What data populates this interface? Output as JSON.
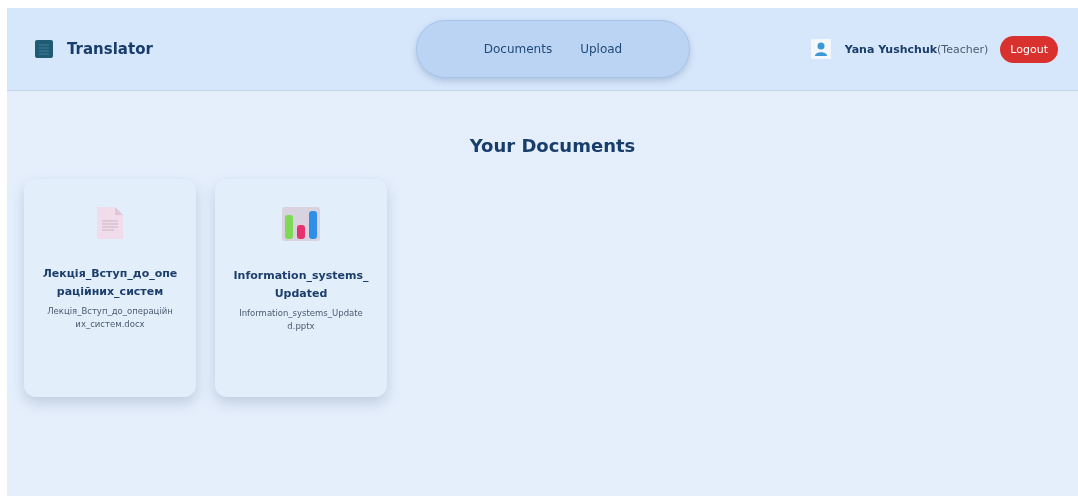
{
  "header": {
    "brand": "Translator",
    "nav": [
      {
        "label": "Documents",
        "selected": false
      },
      {
        "label": "Upload",
        "selected": false
      }
    ],
    "user": {
      "name": "Yana Yushchuk",
      "role": "(Teacher)"
    },
    "logout": "Logout"
  },
  "page_title": "Your Documents",
  "documents": [
    {
      "kind": "docx",
      "title": "Лекція_Вступ_до_операційних_систем",
      "filename": "Лекція_Вступ_до_операційних_систем.docx"
    },
    {
      "kind": "pptx",
      "title": "Information_systems_Updated",
      "filename": "Information_systems_Updated.pptx"
    }
  ]
}
